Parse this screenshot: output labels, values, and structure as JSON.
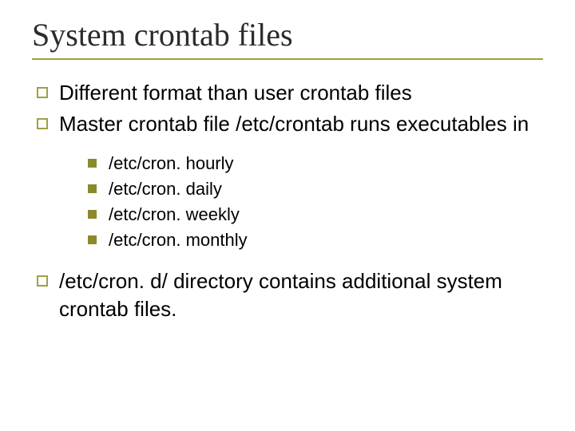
{
  "title": "System crontab files",
  "bullets": [
    "Different format than user crontab files",
    "Master crontab file /etc/crontab runs executables in"
  ],
  "subbullets": [
    "/etc/cron. hourly",
    "/etc/cron. daily",
    "/etc/cron. weekly",
    "/etc/cron. monthly"
  ],
  "bullets2": [
    "/etc/cron. d/ directory contains additional system crontab files."
  ]
}
